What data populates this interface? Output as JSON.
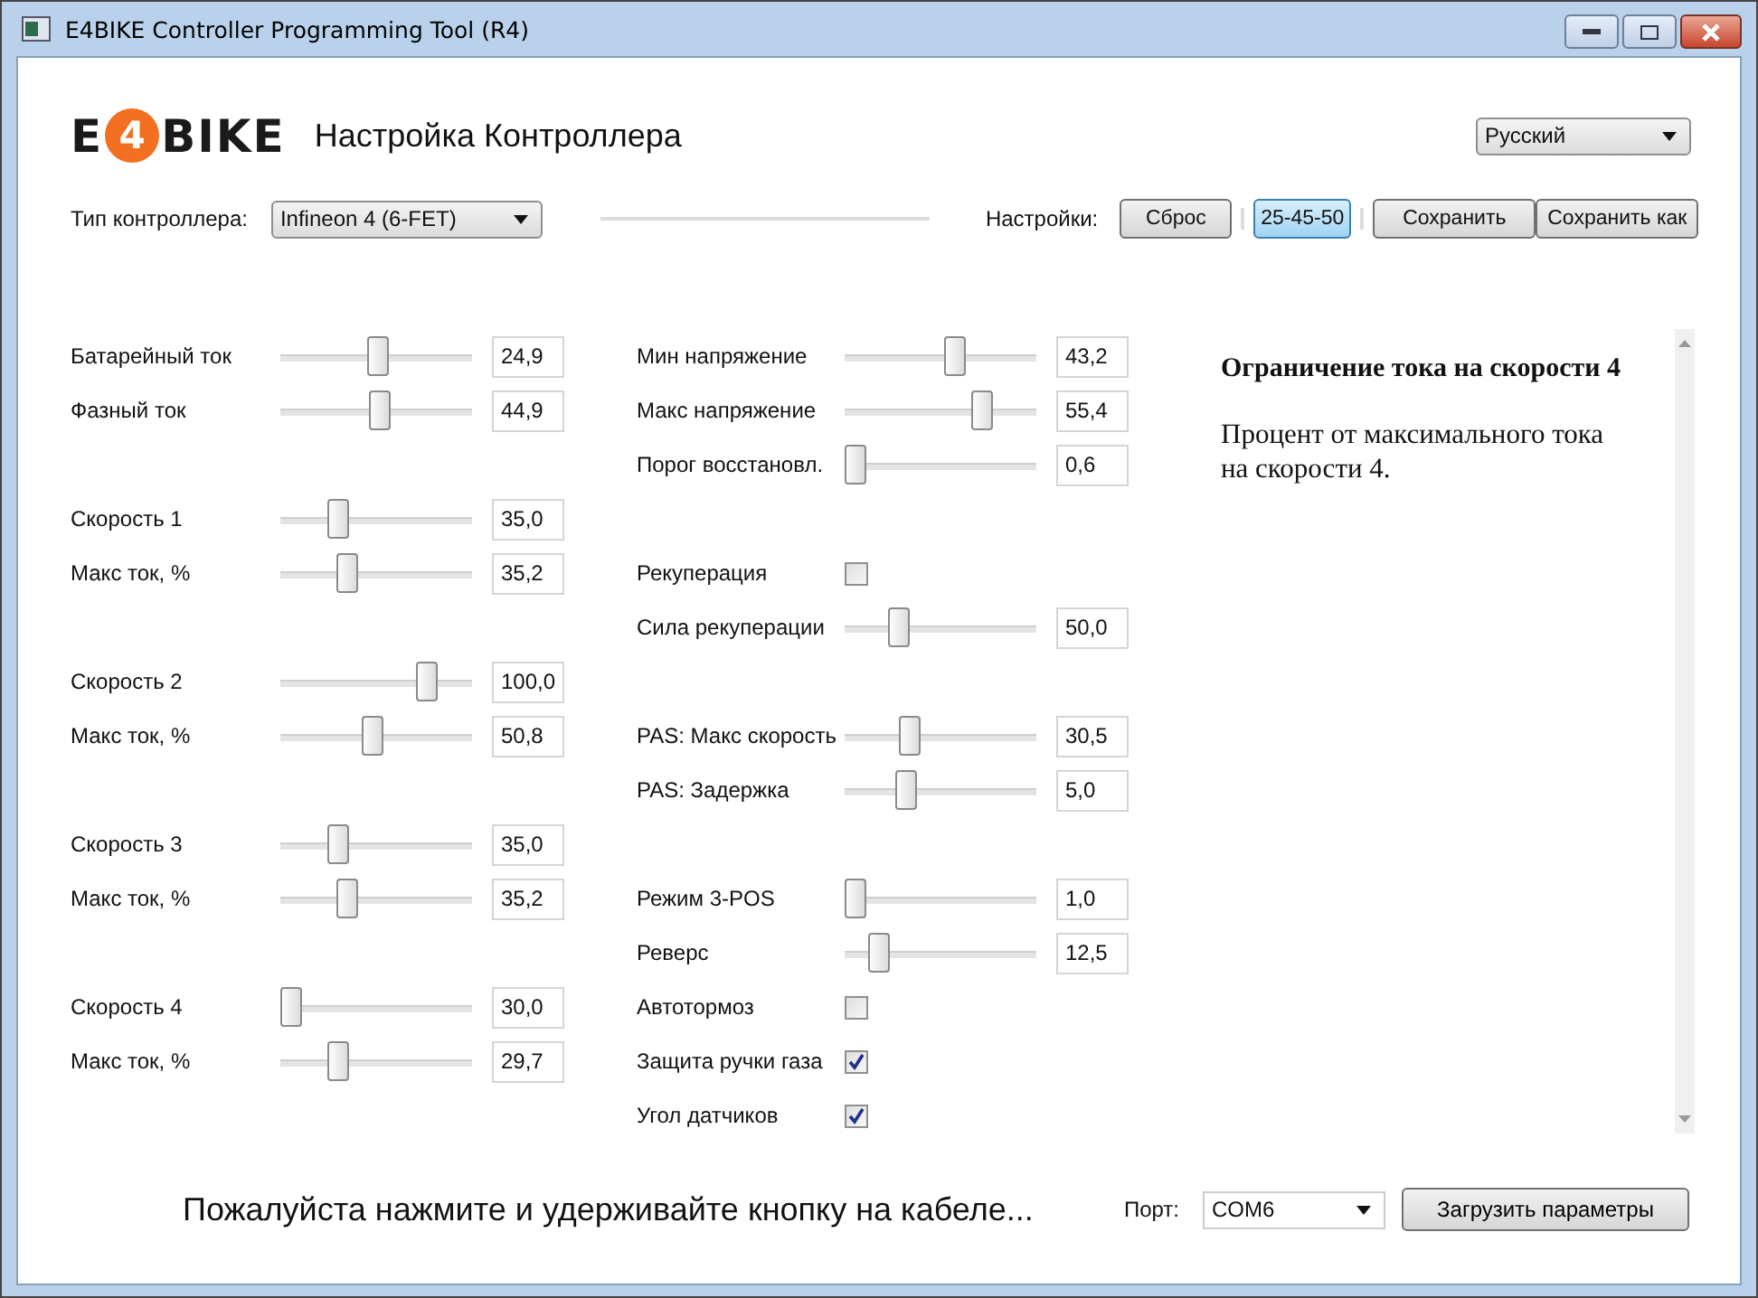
{
  "window": {
    "title": "E4BIKE Controller Programming Tool (R4)"
  },
  "logo": {
    "left": "E",
    "mark": "4",
    "right": "BIKE"
  },
  "heading": "Настройка Контроллера",
  "language": {
    "value": "Русский"
  },
  "controller_type": {
    "label": "Тип контроллера:",
    "value": "Infineon 4 (6-FET)"
  },
  "presets": {
    "label": "Настройки:",
    "buttons": [
      {
        "label": "Сброс",
        "selected": false
      },
      {
        "label": "25-45-50",
        "selected": true
      },
      {
        "label": "Сохранить",
        "selected": false
      },
      {
        "label": "Сохранить как",
        "selected": false
      }
    ]
  },
  "left_groups": [
    [
      {
        "kind": "slider",
        "label": "Батарейный ток",
        "level": 0.5,
        "value": "24,9"
      },
      {
        "kind": "slider",
        "label": "Фазный ток",
        "level": 0.51,
        "value": "44,9"
      }
    ],
    [
      {
        "kind": "slider",
        "label": "Скорость 1",
        "level": 0.27,
        "value": "35,0"
      },
      {
        "kind": "slider",
        "label": "Макс ток, %",
        "level": 0.32,
        "value": "35,2"
      }
    ],
    [
      {
        "kind": "slider",
        "label": "Скорость 2",
        "level": 0.78,
        "value": "100,0"
      },
      {
        "kind": "slider",
        "label": "Макс ток, %",
        "level": 0.47,
        "value": "50,8"
      }
    ],
    [
      {
        "kind": "slider",
        "label": "Скорость 3",
        "level": 0.27,
        "value": "35,0"
      },
      {
        "kind": "slider",
        "label": "Макс ток, %",
        "level": 0.32,
        "value": "35,2"
      }
    ],
    [
      {
        "kind": "slider",
        "label": "Скорость 4",
        "level": 0,
        "value": "30,0"
      },
      {
        "kind": "slider",
        "label": "Макс ток, %",
        "level": 0.27,
        "value": "29,7"
      }
    ]
  ],
  "middle_groups": [
    [
      {
        "kind": "slider",
        "label": "Мин напряжение",
        "level": 0.57,
        "value": "43,2"
      },
      {
        "kind": "slider",
        "label": "Макс напряжение",
        "level": 0.73,
        "value": "55,4"
      },
      {
        "kind": "slider",
        "label": "Порог восстановл.",
        "level": 0,
        "value": "0,6"
      }
    ],
    [
      {
        "kind": "checkbox",
        "label": "Рекуперация",
        "checked": false
      },
      {
        "kind": "slider",
        "label": "Сила рекуперации",
        "level": 0.25,
        "value": "50,0"
      }
    ],
    [
      {
        "kind": "slider",
        "label": "PAS: Макс скорость",
        "level": 0.31,
        "value": "30,5"
      },
      {
        "kind": "slider",
        "label": "PAS: Задержка",
        "level": 0.29,
        "value": "5,0"
      }
    ],
    [
      {
        "kind": "slider",
        "label": "Режим 3-POS",
        "level": 0,
        "value": "1,0"
      },
      {
        "kind": "slider",
        "label": "Реверс",
        "level": 0.14,
        "value": "12,5"
      },
      {
        "kind": "checkbox",
        "label": "Автотормоз",
        "checked": false
      },
      {
        "kind": "checkbox",
        "label": "Защита ручки газа",
        "checked": true
      },
      {
        "kind": "checkbox",
        "label": "Угол датчиков",
        "checked": true
      }
    ]
  ],
  "help": {
    "title": "Ограничение тока на скорости 4",
    "text": "Процент от максимального тока на скорости 4."
  },
  "status": "Пожалуйста нажмите и удерживайте кнопку на кабеле...",
  "port": {
    "label": "Порт:",
    "value": "COM6"
  },
  "upload_button": "Загрузить параметры"
}
